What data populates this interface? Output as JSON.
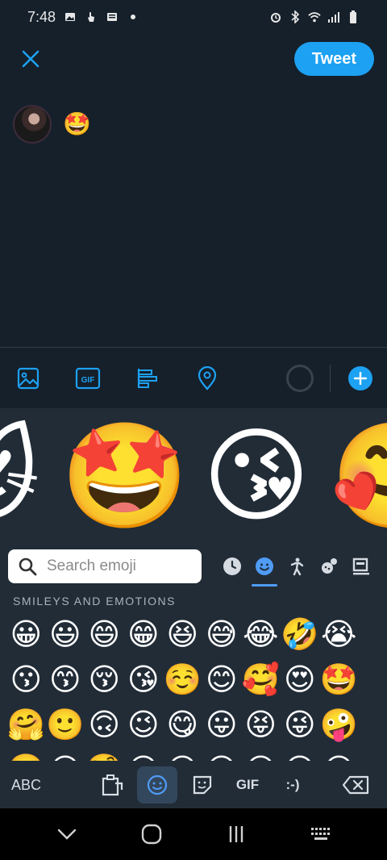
{
  "status_bar": {
    "time": "7:48",
    "left_icons": [
      "image-icon",
      "hand-icon",
      "news-icon",
      "dot-icon"
    ],
    "right_icons": [
      "alarm-icon",
      "bluetooth-icon",
      "wifi-icon",
      "signal-icon",
      "battery-icon"
    ]
  },
  "header": {
    "tweet_label": "Tweet"
  },
  "compose": {
    "text": "🤩"
  },
  "toolbar": {
    "icons": [
      "image-icon",
      "gif-icon",
      "poll-icon",
      "location-icon"
    ],
    "gif_label": "GIF"
  },
  "keyboard": {
    "suggestions": [
      "😻",
      "🤩",
      "😘",
      "🥰"
    ],
    "search": {
      "placeholder": "Search emoji"
    },
    "categories": [
      "recent-icon",
      "smiley-icon",
      "person-icon",
      "activity-icon",
      "food-icon"
    ],
    "section_label": "SMILEYS AND EMOTIONS",
    "emojis": [
      "😀",
      "😃",
      "😄",
      "😁",
      "😆",
      "😅",
      "😂",
      "🤣",
      "😭",
      "😗",
      "😙",
      "😚",
      "😘",
      "☺️",
      "😊",
      "🥰",
      "😍",
      "🤩",
      "🤗",
      "🙂",
      "🙃",
      "😉",
      "😋",
      "😛",
      "😝",
      "😜",
      "🤪",
      "🤭",
      "😒",
      "🧐",
      "😐",
      "😑",
      "😶",
      "😔",
      "😕",
      "😐"
    ],
    "bottom": {
      "abc": "ABC",
      "gif": "GIF",
      "emoticon": ":-)"
    }
  },
  "colors": {
    "background": "#15202b",
    "accent": "#1da1f2",
    "keyboard": "#212c37"
  }
}
